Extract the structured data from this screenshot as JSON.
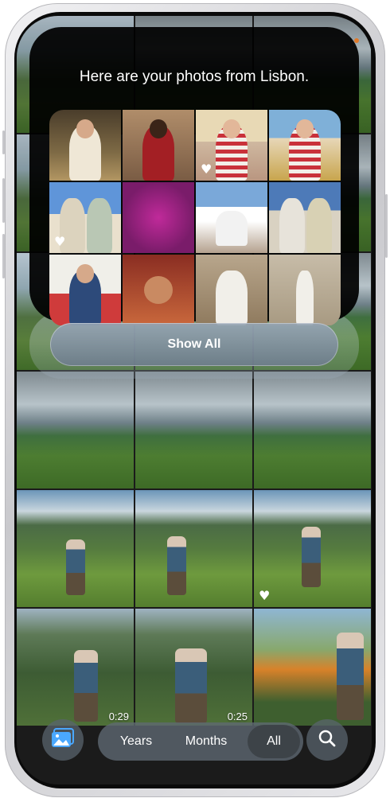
{
  "memory": {
    "title": "Here are your photos from Lisbon.",
    "show_all_label": "Show All",
    "favorite_icon": "♥"
  },
  "grid": {
    "durations": [
      "0:29",
      "0:25"
    ],
    "favorite_icon": "♥"
  },
  "toolbar": {
    "library_icon": "photo-library-icon",
    "segments": [
      "Years",
      "Months",
      "All"
    ],
    "selected_segment": "All",
    "search_icon": "magnifier-icon"
  }
}
